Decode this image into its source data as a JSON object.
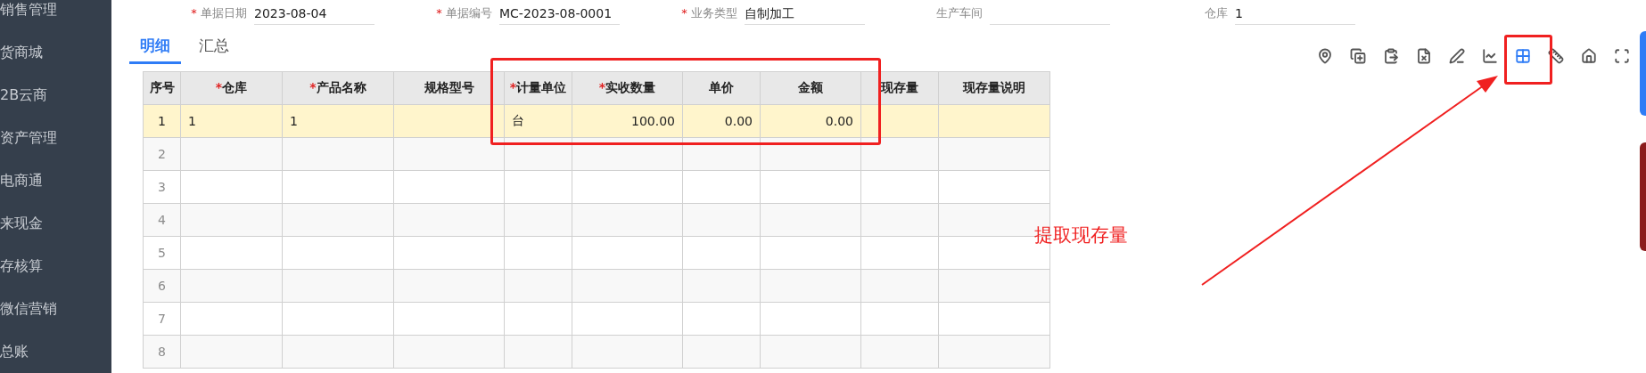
{
  "sidebar": {
    "items": [
      {
        "label": "销售管理"
      },
      {
        "label": "货商城"
      },
      {
        "label": "2B云商"
      },
      {
        "label": "资产管理"
      },
      {
        "label": "电商通"
      },
      {
        "label": "来现金"
      },
      {
        "label": "存核算"
      },
      {
        "label": "微信营销"
      },
      {
        "label": "总账"
      }
    ]
  },
  "header_fields": [
    {
      "mark": "*",
      "label": "单据日期",
      "value": "2023-08-04"
    },
    {
      "mark": "*",
      "label": "单据编号",
      "value": "MC-2023-08-0001"
    },
    {
      "mark": "*",
      "label": "业务类型",
      "value": "自制加工"
    },
    {
      "label": "生产车间"
    },
    {
      "label": "仓库",
      "value": "1"
    }
  ],
  "tabs": [
    {
      "label": "明细",
      "selected": true
    },
    {
      "label": "汇总",
      "selected": false
    }
  ],
  "toolbar": [
    {
      "selected": false
    },
    {
      "selected": false
    },
    {
      "selected": false
    },
    {
      "selected": false
    },
    {
      "selected": false
    },
    {
      "selected": false
    },
    {
      "selected": true
    },
    {
      "selected": false
    },
    {
      "selected": false
    },
    {
      "selected": false
    }
  ],
  "table": {
    "columns": [
      {
        "label": "序号",
        "kind": "index"
      },
      {
        "mark": "*",
        "label": "仓库",
        "kind": "text"
      },
      {
        "mark": "*",
        "label": "产品名称",
        "kind": "text"
      },
      {
        "label": "规格型号",
        "kind": "text"
      },
      {
        "mark": "*",
        "label": "计量单位",
        "kind": "text"
      },
      {
        "mark": "*",
        "label": "实收数量",
        "kind": "number"
      },
      {
        "label": "单价",
        "kind": "number"
      },
      {
        "label": "金额",
        "kind": "number"
      },
      {
        "label": "现存量",
        "kind": "number"
      },
      {
        "label": "现存量说明",
        "kind": "text"
      }
    ],
    "rows": [
      {
        "selected": true,
        "cells": [
          "1",
          "1",
          "1",
          null,
          "台",
          "100.00",
          "0.00",
          "0.00",
          null,
          null
        ]
      },
      {
        "selected": false,
        "cells": [
          "2"
        ]
      },
      {
        "selected": false,
        "cells": [
          "3"
        ]
      },
      {
        "selected": false,
        "cells": [
          "4"
        ]
      },
      {
        "selected": false,
        "cells": [
          "5"
        ]
      },
      {
        "selected": false,
        "cells": [
          "6"
        ]
      },
      {
        "selected": false,
        "cells": [
          "7"
        ]
      },
      {
        "selected": false,
        "cells": [
          "8"
        ]
      }
    ]
  },
  "annotation": {
    "text": "提取现存量"
  }
}
